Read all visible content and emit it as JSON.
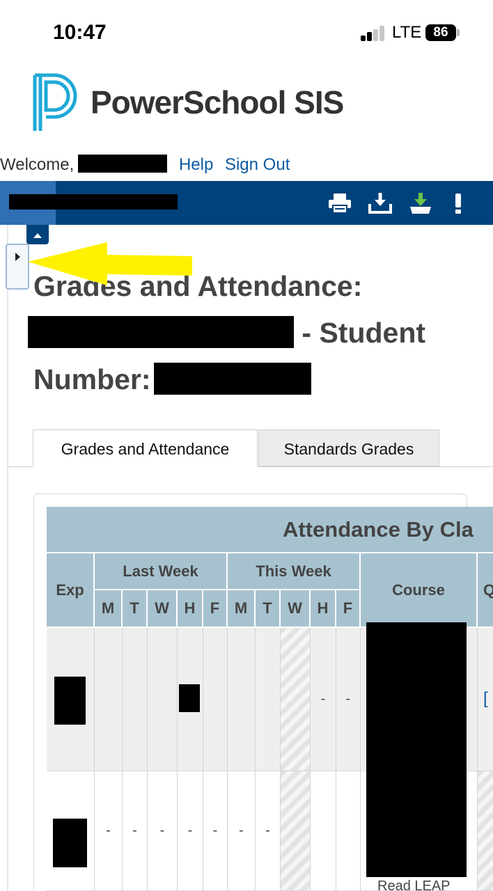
{
  "status_bar": {
    "time": "10:47",
    "network": "LTE",
    "battery": "86"
  },
  "header": {
    "brand": "PowerSchool SIS",
    "welcome": "Welcome,",
    "help": "Help",
    "sign_out": "Sign Out"
  },
  "nav": {
    "icons": [
      "printer-icon",
      "download-icon",
      "download-green-icon",
      "alert-icon"
    ]
  },
  "page": {
    "title_1": "Grades and Attendance:",
    "title_2": "- Student",
    "title_3": "Number:"
  },
  "tabs": [
    {
      "label": "Grades and Attendance",
      "active": true
    },
    {
      "label": "Standards Grades",
      "active": false
    }
  ],
  "table": {
    "caption": "Attendance By Cla",
    "headers": {
      "exp": "Exp",
      "last_week": "Last Week",
      "this_week": "This Week",
      "course": "Course",
      "next": "Q"
    },
    "days": [
      "M",
      "T",
      "W",
      "H",
      "F",
      "M",
      "T",
      "W",
      "H",
      "F"
    ],
    "rows": [
      {
        "cells": [
          "",
          "",
          "",
          "",
          "",
          "",
          "",
          "",
          "-",
          "-"
        ],
        "link": "["
      },
      {
        "cells": [
          "-",
          "-",
          "-",
          "-",
          "-",
          "-",
          "-",
          "",
          "",
          ""
        ],
        "course_fragment": "Read LEAP"
      }
    ]
  },
  "colors": {
    "nav_blue": "#00427c",
    "header_teal": "#a7c2cf",
    "link_blue": "#0a5aa0",
    "arrow_yellow": "#fff200"
  }
}
